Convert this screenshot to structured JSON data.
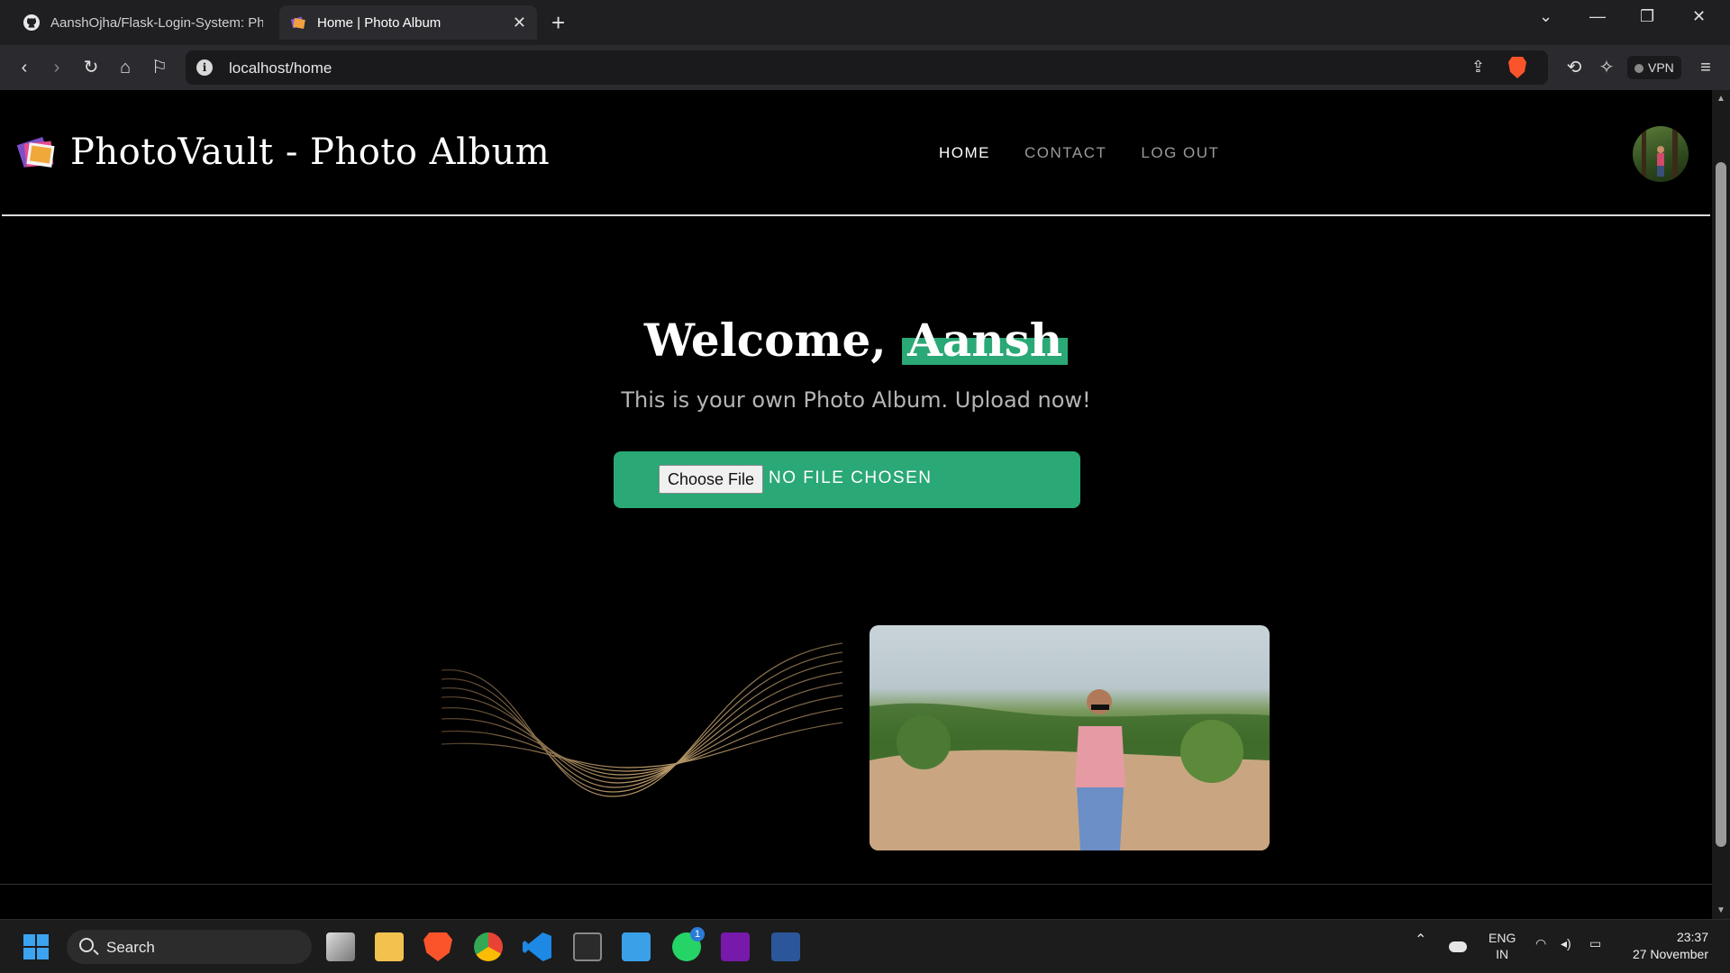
{
  "browser": {
    "tabs": [
      {
        "label": "AanshOjha/Flask-Login-System: Pho",
        "active": false
      },
      {
        "label": "Home | Photo Album",
        "active": true
      }
    ],
    "url": "localhost/home",
    "vpn_label": "VPN"
  },
  "site": {
    "brand_title": "PhotoVault - Photo Album",
    "nav": [
      {
        "label": "HOME",
        "active": true
      },
      {
        "label": "CONTACT",
        "active": false
      },
      {
        "label": "LOG OUT",
        "active": false
      }
    ],
    "welcome_prefix": "Welcome,",
    "user_name": "Aansh",
    "subtitle": "This is your own Photo Album. Upload now!",
    "upload": {
      "button_label": "Choose File",
      "status": "NO FILE CHOSEN"
    },
    "accent_color": "#2aa876"
  },
  "taskbar": {
    "search_label": "Search",
    "lang_line1": "ENG",
    "lang_line2": "IN",
    "time": "23:37",
    "date": "27 November",
    "whatsapp_badge": "1"
  }
}
